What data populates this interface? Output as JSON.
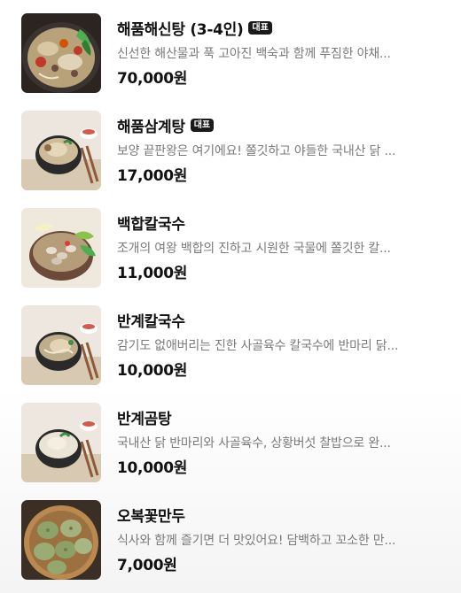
{
  "menu": {
    "badge_label": "대표",
    "items": [
      {
        "name": "해품해신탕 (3-4인)",
        "description": "신선한 해산물과 푹 고아진 백숙과 함께 푸짐한 야채...",
        "price": "70,000원",
        "image_icon": "seafood-hotpot-photo"
      },
      {
        "name": "해품삼계탕",
        "description": "보양 끝판왕은 여기에요! 쫄깃하고 야들한 국내산 닭 ...",
        "price": "17,000원",
        "image_icon": "samgyetang-photo"
      },
      {
        "name": "백합칼국수",
        "description": "조개의 여왕 백합의 진하고 시원한 국물에 쫄깃한 칼...",
        "price": "11,000원",
        "image_icon": "clam-noodle-photo"
      },
      {
        "name": "반계칼국수",
        "description": "감기도 없애버리는 진한 사골육수 칼국수에 반마리 닭...",
        "price": "10,000원",
        "image_icon": "half-chicken-noodle-photo"
      },
      {
        "name": "반계곰탕",
        "description": "국내산 닭 반마리와 사골육수, 상황버섯 찰밥으로 완...",
        "price": "10,000원",
        "image_icon": "half-chicken-gomtang-photo"
      },
      {
        "name": "오복꽃만두",
        "description": "식사와 함께 즐기면 더 맛있어요! 담백하고 꼬소한 만...",
        "price": "7,000원",
        "image_icon": "dumplings-photo"
      }
    ]
  }
}
